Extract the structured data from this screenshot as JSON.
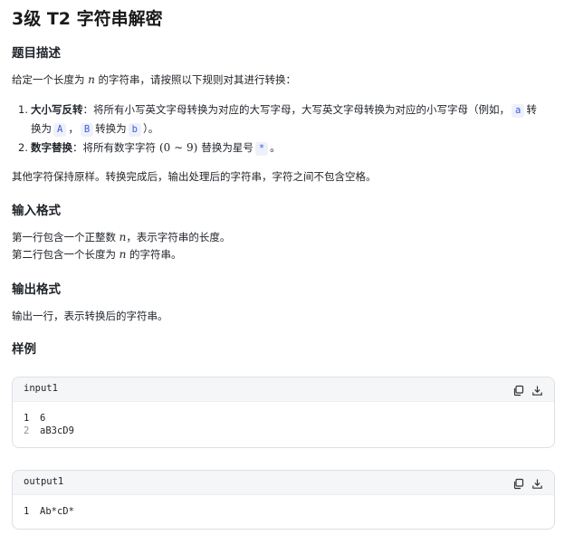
{
  "title": "3级 T2 字符串解密",
  "sections": {
    "desc_heading": "题目描述",
    "desc_intro_a": "给定一个长度为",
    "desc_intro_var": "n",
    "desc_intro_b": "的字符串，请按照以下规则对其进行转换：",
    "rule1_num": "1.",
    "rule1_bold": "大小写反转",
    "rule1_text_a": "：将所有小写英文字母转换为对应的大写字母，大写英文字母转换为对应的小写字母（例如，",
    "rule1_code_a": "a",
    "rule1_text_b": "转",
    "rule1_text_c": "换为",
    "rule1_code_A": "A",
    "rule1_text_d": "，",
    "rule1_code_B": "B",
    "rule1_text_e": "转换为",
    "rule1_code_b": "b",
    "rule1_text_f": "）。",
    "rule2_num": "2.",
    "rule2_bold": "数字替换",
    "rule2_text_a": "：将所有数字字符",
    "rule2_math": "(0 ∼ 9)",
    "rule2_text_b": "替换为星号",
    "rule2_code": "*",
    "rule2_text_c": "。",
    "desc_outro": "其他字符保持原样。转换完成后，输出处理后的字符串，字符之间不包含空格。",
    "input_heading": "输入格式",
    "input_line1_a": "第一行包含一个正整数",
    "input_line1_var": "n",
    "input_line1_b": "，表示字符串的长度。",
    "input_line2_a": "第二行包含一个长度为",
    "input_line2_var": "n",
    "input_line2_b": "的字符串。",
    "output_heading": "输出格式",
    "output_line": "输出一行，表示转换后的字符串。",
    "sample_heading": "样例"
  },
  "samples": [
    {
      "label": "input1",
      "lines": [
        {
          "no": "1",
          "text": "6"
        },
        {
          "no": "2",
          "text": "aB3cD9"
        }
      ]
    },
    {
      "label": "output1",
      "lines": [
        {
          "no": "1",
          "text": "Ab*cD*"
        }
      ]
    }
  ],
  "icons": {
    "copy": "copy-icon",
    "download": "download-icon"
  },
  "colors": {
    "code_text": "#3b5bdb",
    "code_bg": "#eef1fb",
    "box_border": "#dcdfe4",
    "box_head_bg": "#f5f6f8"
  }
}
